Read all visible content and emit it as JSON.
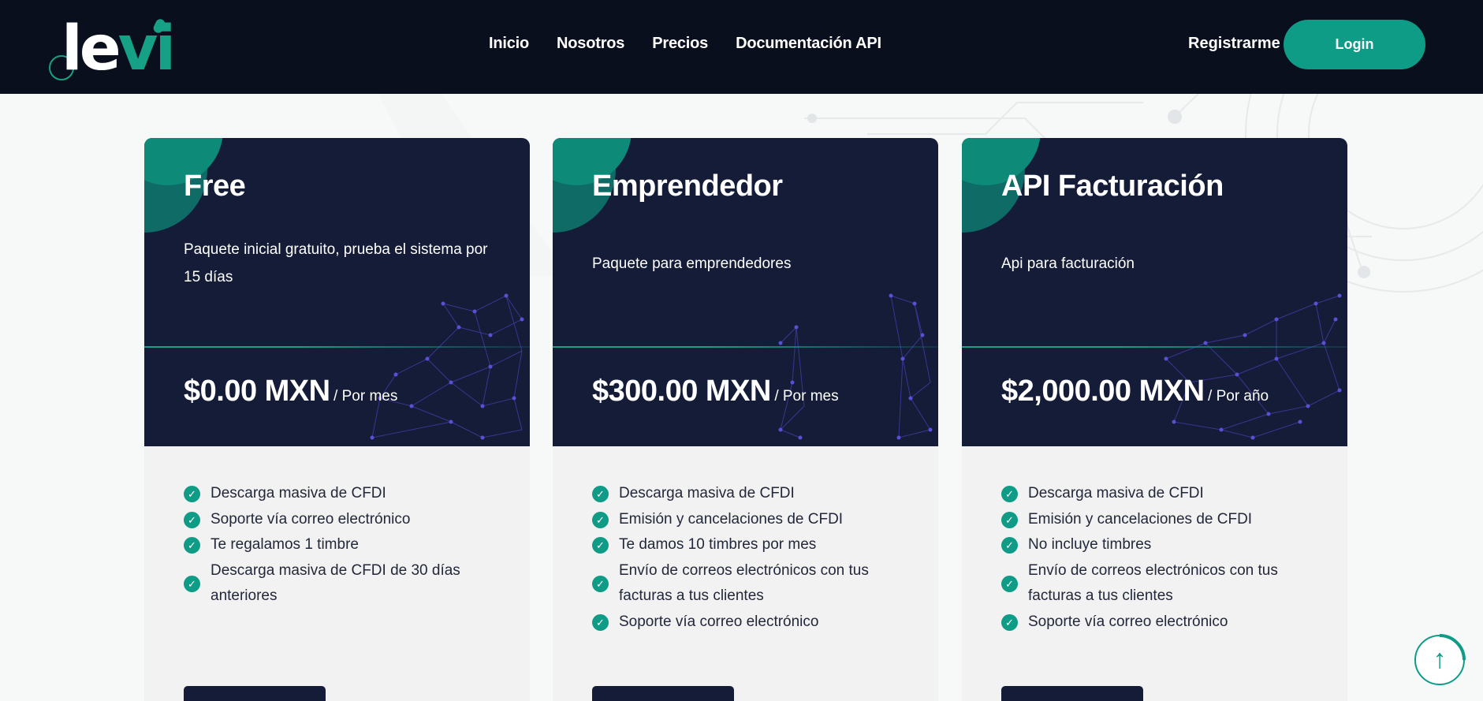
{
  "brand": {
    "logo_text_white": "le",
    "logo_text_teal": "vi",
    "accent_color": "#0e9c87",
    "dark_color": "#151c38"
  },
  "nav": {
    "items": [
      "Inicio",
      "Nosotros",
      "Precios",
      "Documentación API"
    ],
    "register": "Registrarme",
    "login": "Login"
  },
  "plans": [
    {
      "title": "Free",
      "description": "Paquete inicial gratuito, prueba el sistema por 15 días",
      "price": "$0.00 MXN",
      "period": "/ Por mes",
      "features": [
        "Descarga masiva de CFDI",
        "Soporte vía correo electrónico",
        "Te regalamos 1 timbre",
        "Descarga masiva de CFDI de 30 días anteriores"
      ]
    },
    {
      "title": "Emprendedor",
      "description": "Paquete para emprendedores",
      "price": "$300.00 MXN",
      "period": "/ Por mes",
      "features": [
        "Descarga masiva de CFDI",
        "Emisión y cancelaciones de CFDI",
        "Te damos 10 timbres por mes",
        "Envío de correos electrónicos con tus facturas a tus clientes",
        "Soporte vía correo electrónico"
      ]
    },
    {
      "title": "API Facturación",
      "description": "Api para facturación",
      "price": "$2,000.00 MXN",
      "period": "/ Por año",
      "features": [
        "Descarga masiva de CFDI",
        "Emisión y cancelaciones de CFDI",
        "No incluye timbres",
        "Envío de correos electrónicos con tus facturas a tus clientes",
        "Soporte vía correo electrónico"
      ]
    }
  ],
  "icons": {
    "feature_check": "check-circle-icon",
    "scroll_top": "arrow-up-icon"
  }
}
